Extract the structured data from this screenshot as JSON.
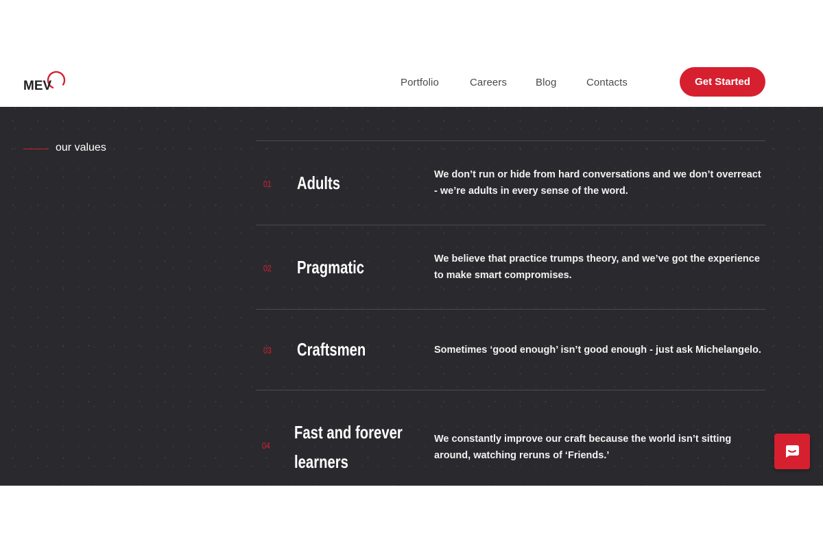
{
  "header": {
    "logo_text": "MEV",
    "nav": [
      "Portfolio",
      "Careers",
      "Blog",
      "Contacts"
    ],
    "cta_label": "Get Started"
  },
  "section": {
    "label": "our values",
    "items": [
      {
        "num": "01",
        "title": "Adults",
        "desc": "We don’t run or hide from hard conversations and we don’t overreact - we’re adults in every sense of the word."
      },
      {
        "num": "02",
        "title": "Pragmatic",
        "desc": "We believe that practice trumps theory, and we’ve got the experience to make smart compromises."
      },
      {
        "num": "03",
        "title": "Craftsmen",
        "desc": "Sometimes ‘good enough’ isn’t good enough - just ask Michelangelo."
      },
      {
        "num": "04",
        "title_lines": [
          "Fast and forever",
          "learners"
        ],
        "desc": "We constantly improve our craft because the world isn’t sitting around, watching reruns of ‘Friends.’"
      }
    ]
  },
  "colors": {
    "accent": "#d6202f",
    "dark_bg": "#2a2a2e",
    "divider": "#4b4b50"
  },
  "icons": {
    "chat": "chat-bubble-icon",
    "logo": "mev-logo-icon"
  }
}
